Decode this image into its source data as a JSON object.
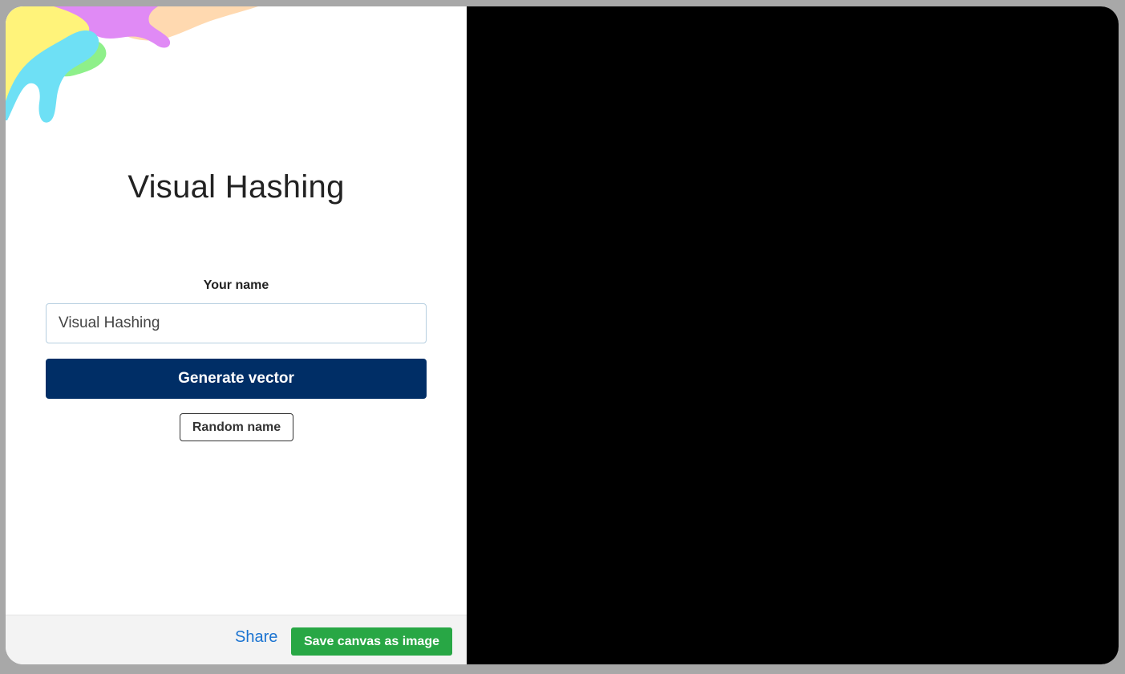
{
  "header": {
    "title": "Visual Hashing"
  },
  "form": {
    "name_label": "Your name",
    "name_value": "Visual Hashing",
    "generate_label": "Generate vector",
    "random_label": "Random name"
  },
  "footer": {
    "share_label": "Share",
    "save_label": "Save canvas as image"
  },
  "colors": {
    "primary_button": "#002e66",
    "save_button": "#28a745",
    "link": "#1a73d1",
    "canvas_background": "#000000",
    "blob_yellow": "#fff37a",
    "blob_cyan": "#6ee0f5",
    "blob_green": "#8ef08a",
    "blob_violet": "#e08af5",
    "blob_peach": "#ffd9b0"
  },
  "icons": {
    "decor": "color-blob-decoration"
  }
}
